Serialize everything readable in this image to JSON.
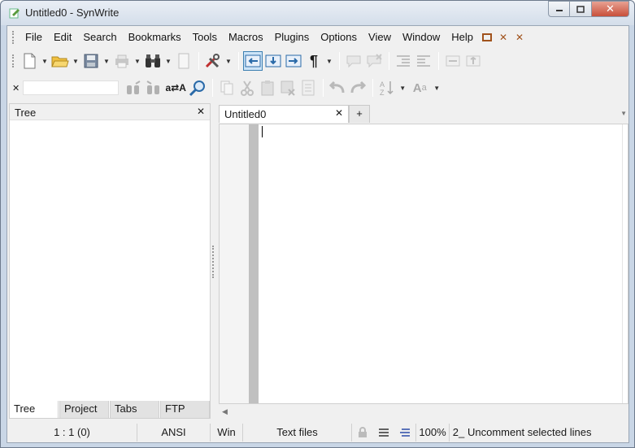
{
  "window": {
    "title": "Untitled0 - SynWrite"
  },
  "menu": [
    "File",
    "Edit",
    "Search",
    "Bookmarks",
    "Tools",
    "Macros",
    "Plugins",
    "Options",
    "View",
    "Window",
    "Help"
  ],
  "find_bar": {
    "input_value": "",
    "replace_label": "a⇄A"
  },
  "left_panel": {
    "header": "Tree",
    "tabs": [
      "Tree",
      "Project",
      "Tabs",
      "FTP"
    ],
    "selected_tab": "Tree"
  },
  "editor": {
    "tab_label": "Untitled0",
    "add_tab_label": "+"
  },
  "status": {
    "position": "1 : 1 (0)",
    "encoding": "ANSI",
    "line_ending": "Win",
    "lexer": "Text files",
    "zoom": "100%",
    "column_marker": "2_",
    "hint": "Uncomment selected lines"
  },
  "colors": {
    "accent": "#3c7fb1",
    "close_button": "#c8503b",
    "gutter": "#c0c0c0"
  }
}
